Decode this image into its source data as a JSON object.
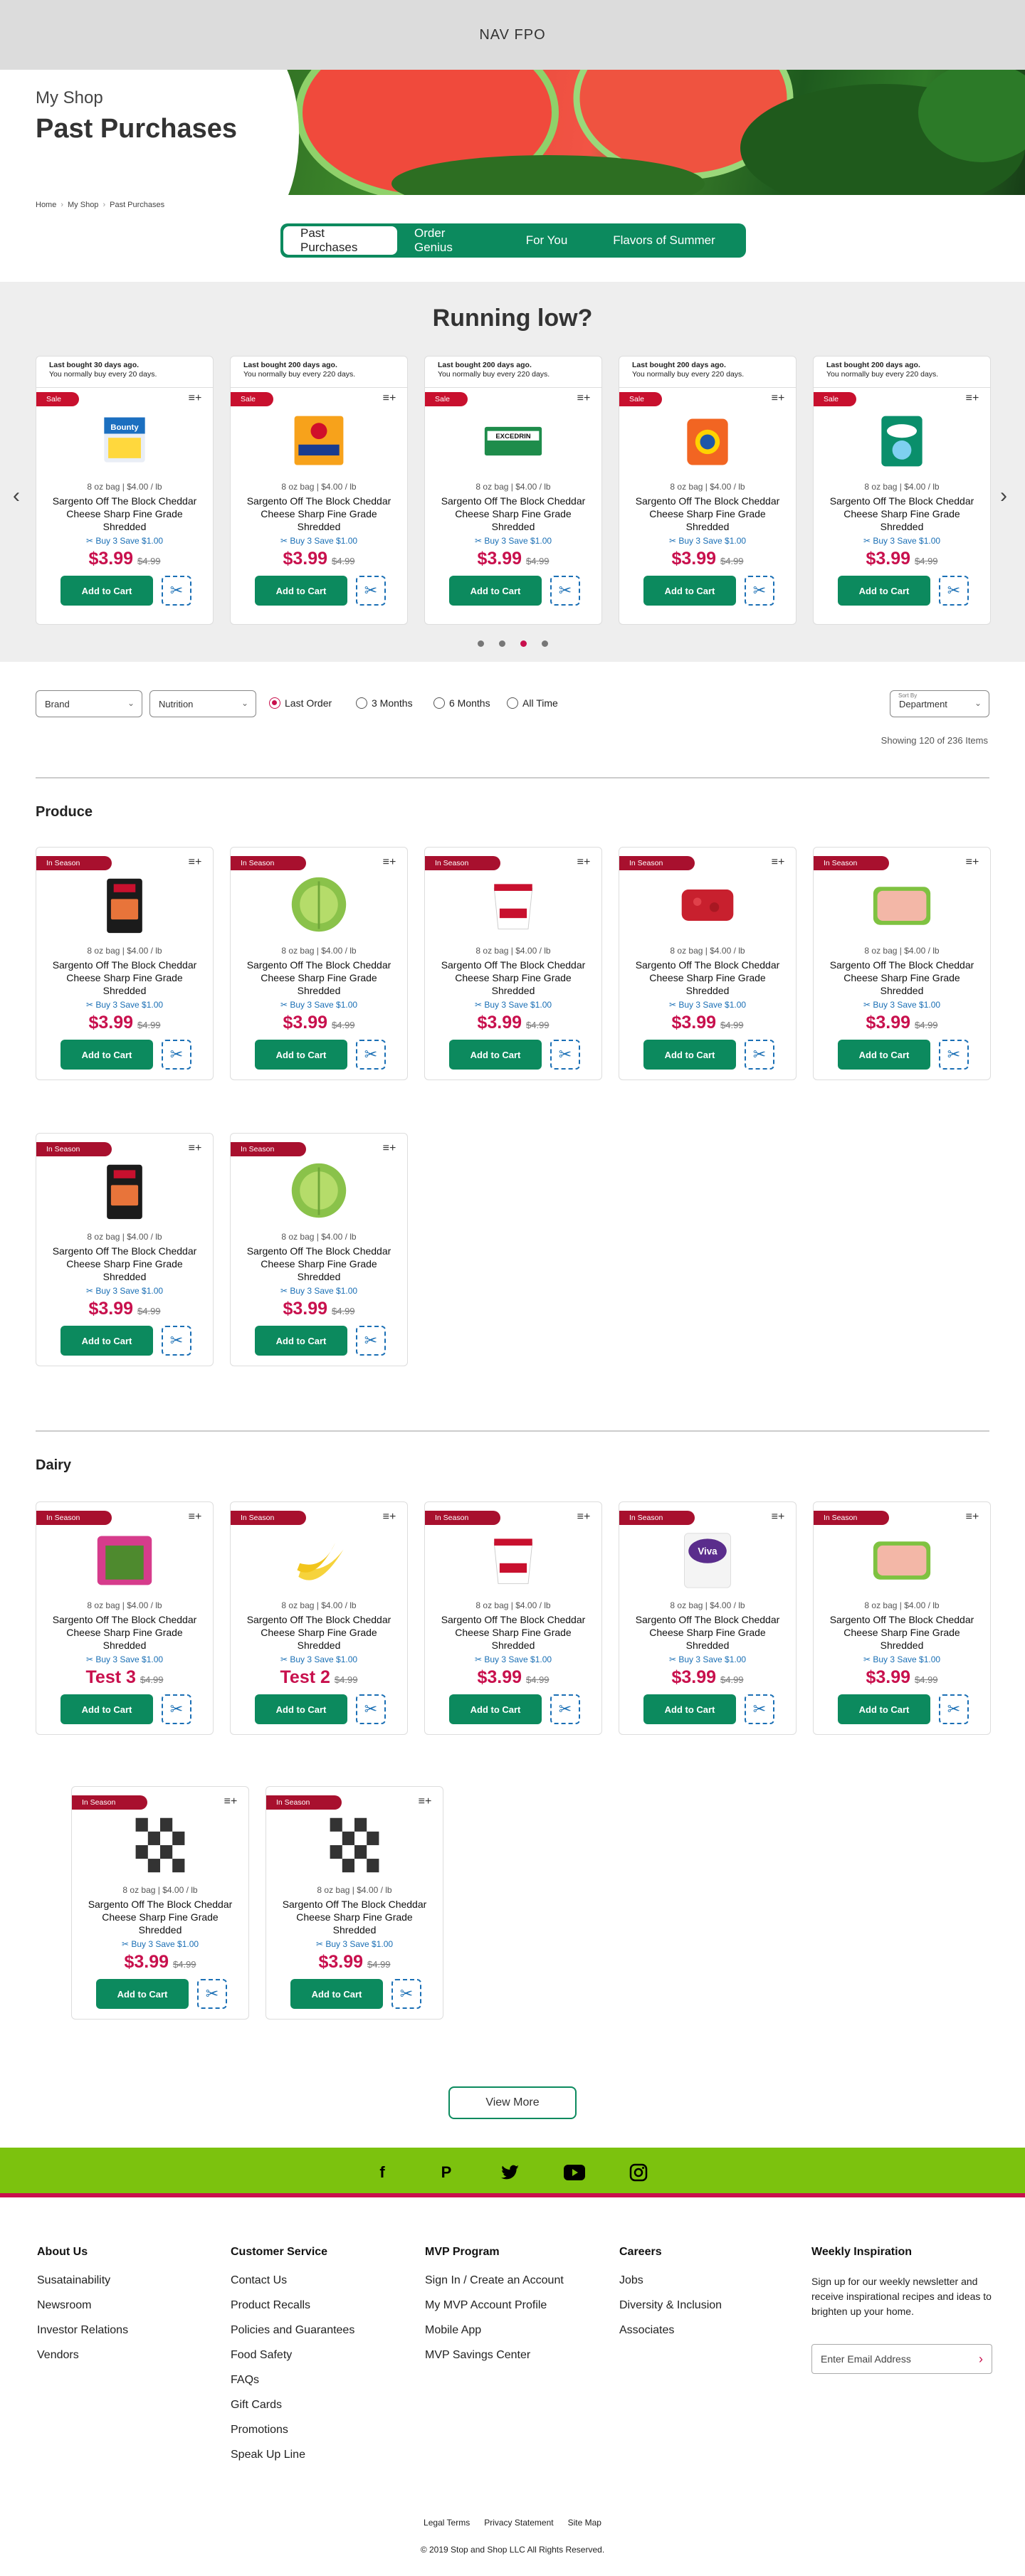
{
  "topbar": {
    "label": "NAV FPO"
  },
  "hero": {
    "subtitle": "My Shop",
    "title": "Past Purchases"
  },
  "breadcrumb": {
    "home": "Home",
    "myshop": "My Shop",
    "current": "Past Purchases"
  },
  "tabs": [
    "Past Purchases",
    "Order Genius",
    "For You",
    "Flavors of Summer"
  ],
  "running_low": {
    "title": "Running low?",
    "cards": [
      {
        "last": "Last bought 30 days ago.",
        "usual": "You normally buy every 20 days.",
        "badge": "Sale",
        "img": "bounty"
      },
      {
        "last": "Last bought 200 days ago.",
        "usual": "You normally buy every 220 days.",
        "badge": "Sale",
        "img": "armhammer"
      },
      {
        "last": "Last bought 200 days ago.",
        "usual": "You normally buy every 220 days.",
        "badge": "Sale",
        "img": "excedrin"
      },
      {
        "last": "Last bought 200 days ago.",
        "usual": "You normally buy every 220 days.",
        "badge": "Sale",
        "img": "tide"
      },
      {
        "last": "Last bought 200 days ago.",
        "usual": "You normally buy every 220 days.",
        "badge": "Sale",
        "img": "cascade"
      }
    ]
  },
  "product": {
    "size": "8 oz bag | $4.00 / lb",
    "name": "Sargento Off The Block Cheddar Cheese Sharp Fine Grade Shredded",
    "deal": "Buy 3 Save $1.00",
    "price": "$3.99",
    "old": "$4.99",
    "add": "Add to Cart"
  },
  "filters": {
    "brand": "Brand",
    "nutrition": "Nutrition",
    "radios": [
      "Last Order",
      "3 Months",
      "6 Months",
      "All Time"
    ],
    "dept_label": "Sort By",
    "dept": "Department",
    "showing": "Showing 120 of 236 Items"
  },
  "produce": {
    "title": "Produce",
    "cards": [
      {
        "badge": "In Season",
        "img": "cheese",
        "price": "$3.99"
      },
      {
        "badge": "In Season",
        "img": "lettuce",
        "price": "$3.99"
      },
      {
        "badge": "In Season",
        "img": "sourcream",
        "price": "$3.99"
      },
      {
        "badge": "In Season",
        "img": "beef",
        "price": "$3.99"
      },
      {
        "badge": "In Season",
        "img": "turkey",
        "price": "$3.99"
      },
      {
        "badge": "In Season",
        "img": "cheese",
        "price": "$3.99"
      },
      {
        "badge": "In Season",
        "img": "lettuce",
        "price": "$3.99"
      }
    ]
  },
  "dairy": {
    "title": "Dairy",
    "cards": [
      {
        "badge": "In Season",
        "img": "beans",
        "price": "Test 3"
      },
      {
        "badge": "In Season",
        "img": "banana",
        "price": "Test 2"
      },
      {
        "badge": "In Season",
        "img": "sourcream",
        "price": "$3.99"
      },
      {
        "badge": "In Season",
        "img": "viva",
        "price": "$3.99"
      },
      {
        "badge": "In Season",
        "img": "turkey",
        "price": "$3.99"
      },
      {
        "badge": "In Season",
        "img": "checker",
        "price": "$3.99"
      },
      {
        "badge": "In Season",
        "img": "checker",
        "price": "$3.99"
      }
    ]
  },
  "view_more": "View More",
  "social": [
    "facebook-icon",
    "pinterest-icon",
    "twitter-icon",
    "youtube-icon",
    "instagram-icon"
  ],
  "footer": {
    "about": {
      "title": "About Us",
      "links": [
        "Susatainability",
        "Newsroom",
        "Investor Relations",
        "Vendors"
      ]
    },
    "service": {
      "title": "Customer Service",
      "links": [
        "Contact Us",
        "Product Recalls",
        "Policies and Guarantees",
        "Food Safety",
        "FAQs",
        "Gift Cards",
        "Promotions",
        "Speak Up Line"
      ]
    },
    "mvp": {
      "title": "MVP Program",
      "links": [
        "Sign In / Create an Account",
        "My MVP Account Profile",
        "Mobile App",
        "MVP Savings Center"
      ]
    },
    "careers": {
      "title": "Careers",
      "links": [
        "Jobs",
        "Diversity & Inclusion",
        "Associates"
      ]
    },
    "weekly": {
      "title": "Weekly Inspiration",
      "desc": "Sign up for our weekly newsletter and receive inspirational recipes and ideas to brighten up your home.",
      "placeholder": "Enter Email Address"
    },
    "legal": [
      "Legal Terms",
      "Privacy Statement",
      "Site Map"
    ],
    "copyright": "© 2019 Stop and Shop LLC All Rights Reserved."
  },
  "colors": {
    "brand_green": "#0c8a5e",
    "sale_red": "#c8102e",
    "price": "#c8104d",
    "deal_blue": "#1a6fb5",
    "social_green": "#7cc20e"
  }
}
